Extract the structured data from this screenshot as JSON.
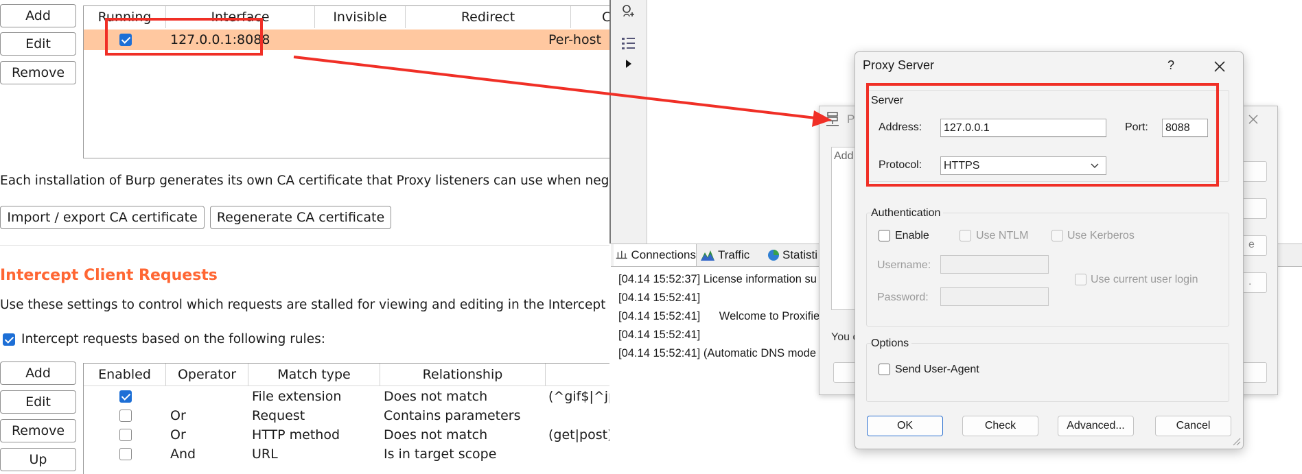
{
  "burp": {
    "listeners_buttons": [
      "Add",
      "Edit",
      "Remove"
    ],
    "listeners_table": {
      "headers": [
        "Running",
        "Interface",
        "Invisible",
        "Redirect",
        "Ce"
      ],
      "row": {
        "running": true,
        "interface": "127.0.0.1:8088",
        "certificate": "Per-host"
      }
    },
    "ca_text": "Each installation of Burp generates its own CA certificate that Proxy listeners can use when negotiating T",
    "import_export_label": "Import / export CA certificate",
    "regenerate_label": "Regenerate CA certificate",
    "intercept_title": "Intercept Client Requests",
    "intercept_desc": "Use these settings to control which requests are stalled for viewing and editing in the Intercept tab.",
    "intercept_checkbox_label": "Intercept requests based on the following rules:",
    "rules_buttons": [
      "Add",
      "Edit",
      "Remove",
      "Up"
    ],
    "rules_table": {
      "headers": [
        "Enabled",
        "Operator",
        "Match type",
        "Relationship"
      ],
      "rows": [
        {
          "enabled": true,
          "operator": "",
          "match_type": "File extension",
          "relationship": "Does not match",
          "condition": "(^gif$|^jp"
        },
        {
          "enabled": false,
          "operator": "Or",
          "match_type": "Request",
          "relationship": "Contains parameters",
          "condition": ""
        },
        {
          "enabled": false,
          "operator": "Or",
          "match_type": "HTTP method",
          "relationship": "Does not match",
          "condition": "(get|post)"
        },
        {
          "enabled": false,
          "operator": "And",
          "match_type": "URL",
          "relationship": "Is in target scope",
          "condition": ""
        }
      ]
    },
    "accent_color": "#ff6633",
    "selection_color": "#ffc8a0"
  },
  "proxifier": {
    "tabs": [
      "Connections",
      "Traffic",
      "Statisti"
    ],
    "log": [
      {
        "time": "[04.14 15:52:37]",
        "msg": "License information su"
      },
      {
        "time": "[04.14 15:52:41]",
        "msg": ""
      },
      {
        "time": "[04.14 15:52:41]",
        "msg": "     Welcome to Proxifie"
      },
      {
        "time": "[04.14 15:52:41]",
        "msg": ""
      },
      {
        "time": "[04.14 15:52:41]",
        "msg": "(Automatic DNS mode"
      }
    ],
    "back_dialog": {
      "title_fragment": "P",
      "add_fragment": "Add",
      "you_fragment": "You c",
      "button_fragments": [
        "e",
        "."
      ]
    }
  },
  "proxy_dialog": {
    "title": "Proxy Server",
    "help": "?",
    "server": {
      "label": "Server",
      "address_label": "Address:",
      "address": "127.0.0.1",
      "port_label": "Port:",
      "port": "8088",
      "protocol_label": "Protocol:",
      "protocol": "HTTPS"
    },
    "auth": {
      "label": "Authentication",
      "enable": "Enable",
      "ntlm": "Use NTLM",
      "kerberos": "Use Kerberos",
      "username_label": "Username:",
      "password_label": "Password:",
      "current_user": "Use current user login"
    },
    "options": {
      "label": "Options",
      "user_agent": "Send User-Agent"
    },
    "buttons": {
      "ok": "OK",
      "check": "Check",
      "advanced": "Advanced...",
      "cancel": "Cancel"
    }
  },
  "annotation_color": "#f02f26"
}
